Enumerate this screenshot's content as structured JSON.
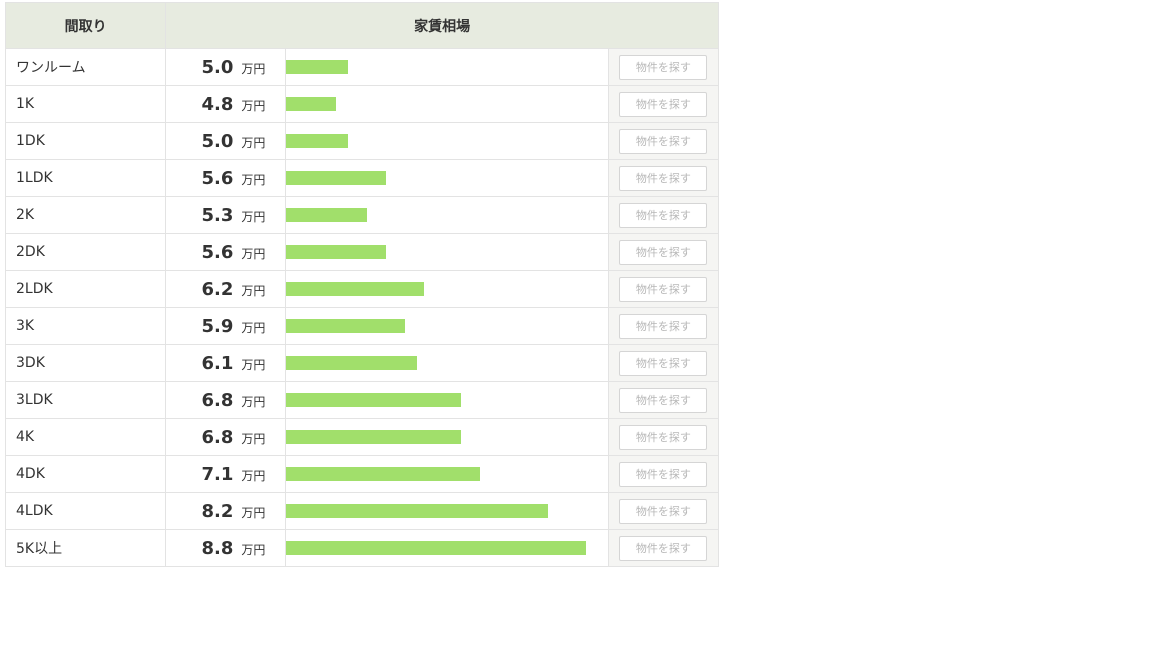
{
  "header": {
    "layout_label": "間取り",
    "rent_label": "家賃相場"
  },
  "unit": "万円",
  "button_label": "物件を探す",
  "bar_color": "#a1df6b",
  "rows": [
    {
      "layout": "ワンルーム",
      "rent": "5.0"
    },
    {
      "layout": "1K",
      "rent": "4.8"
    },
    {
      "layout": "1DK",
      "rent": "5.0"
    },
    {
      "layout": "1LDK",
      "rent": "5.6"
    },
    {
      "layout": "2K",
      "rent": "5.3"
    },
    {
      "layout": "2DK",
      "rent": "5.6"
    },
    {
      "layout": "2LDK",
      "rent": "6.2"
    },
    {
      "layout": "3K",
      "rent": "5.9"
    },
    {
      "layout": "3DK",
      "rent": "6.1"
    },
    {
      "layout": "3LDK",
      "rent": "6.8"
    },
    {
      "layout": "4K",
      "rent": "6.8"
    },
    {
      "layout": "4DK",
      "rent": "7.1"
    },
    {
      "layout": "4LDK",
      "rent": "8.2"
    },
    {
      "layout": "5K以上",
      "rent": "8.8"
    }
  ]
}
